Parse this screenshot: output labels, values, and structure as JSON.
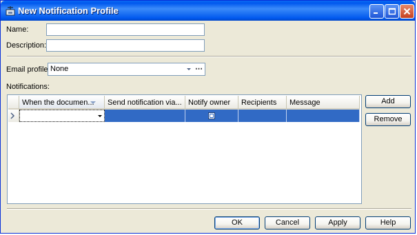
{
  "window": {
    "title": "New Notification Profile"
  },
  "form": {
    "name_label": "Name:",
    "name_value": "",
    "description_label": "Description:",
    "description_value": "",
    "email_profile_label": "Email profile:",
    "email_profile_value": "None",
    "email_profile_more": "⋯",
    "notifications_label": "Notifications:"
  },
  "grid": {
    "columns": [
      "When the documen...",
      "Send notification via...",
      "Notify owner",
      "Recipients",
      "Message"
    ],
    "rows": [
      {
        "when": "",
        "send_via": "",
        "notify_owner": true,
        "recipients": "",
        "message": ""
      }
    ]
  },
  "side_buttons": {
    "add": "Add",
    "remove": "Remove"
  },
  "footer_buttons": {
    "ok": "OK",
    "cancel": "Cancel",
    "apply": "Apply",
    "help": "Help"
  },
  "colors": {
    "selection": "#316ac5",
    "titlebar": "#0058ee",
    "face": "#ece9d8"
  }
}
